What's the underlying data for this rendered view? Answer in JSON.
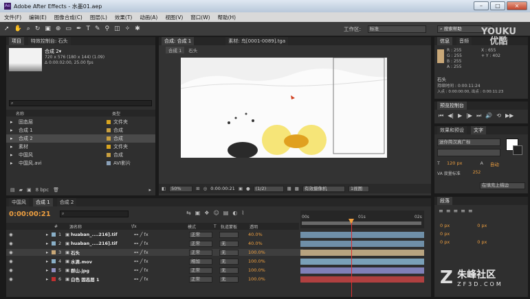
{
  "title": "Adobe After Effects - 水墨01.aep",
  "window_buttons": [
    "–",
    "□",
    "×"
  ],
  "menu": [
    "文件(F)",
    "编辑(E)",
    "图像合成(C)",
    "图层(L)",
    "效果(T)",
    "动画(A)",
    "视图(V)",
    "窗口(W)",
    "帮助(H)"
  ],
  "toolbar": {
    "workspace_label": "工作区:",
    "workspace_value": "标准",
    "search_placeholder": "搜索帮助"
  },
  "project": {
    "tab": "项目",
    "effects_tab": "特效控制台: 石头",
    "comp_name": "合成 2▾",
    "comp_info1": "720 x 576 (180 x 144) (1.09)",
    "comp_info2": "Δ 0:00:02:00, 25.00 fps",
    "col_name": "名称",
    "col_type": "类型",
    "items": [
      {
        "name": "固态层",
        "type": "文件夹",
        "color": "#d9a520",
        "selected": false
      },
      {
        "name": "合成 1",
        "type": "合成",
        "color": "#c9a040",
        "selected": false
      },
      {
        "name": "合成 2",
        "type": "合成",
        "color": "#c9a040",
        "selected": true
      },
      {
        "name": "素材",
        "type": "文件夹",
        "color": "#d9a520",
        "selected": false
      },
      {
        "name": "中国风",
        "type": "合成",
        "color": "#c9a040",
        "selected": false
      },
      {
        "name": "中国风.avi",
        "type": "AVI影片",
        "color": "#8aa0b8",
        "selected": false
      }
    ],
    "bpc": "8 bpc"
  },
  "comp_viewer": {
    "tab": "合成: 合成 1",
    "footage_tab": "素材: 鸟[0001-0089].tga",
    "crumbs": [
      "合成 1",
      "石头"
    ],
    "zoom": "50%",
    "timecode": "0:00:00:21",
    "resolution": "(1/2)",
    "camera": "有效摄像机",
    "views": "1视图"
  },
  "info": {
    "tab": "信息",
    "tab2": "音频",
    "r": "R : 255",
    "g": "G : 255",
    "b": "B : 255",
    "a": "A : 255",
    "x": "X : 655",
    "y": "+ Y : 402",
    "layer": "石头",
    "duration": "持续时间 : 0:00:11:24",
    "inout": "入点 : 0:00:00:00, 出点 : 0:00:11:23"
  },
  "preview": {
    "tab": "预览控制台"
  },
  "effects_panel": {
    "tab": "效果和预设",
    "tab2": "文字"
  },
  "text_panel": {
    "font": "迷你简汉真广标",
    "size": "120 px",
    "leading": "自动",
    "tracking": "VA 度量标准",
    "tracking_val": "252",
    "fill_stroke": "在填充上描边"
  },
  "paragraph": {
    "tab": "段落",
    "v1": "0 px",
    "v2": "0 px",
    "v3": "0 px",
    "v4": "0 px",
    "v5": "0 px"
  },
  "timeline": {
    "tabs": [
      "中国风",
      "合成 1",
      "合成 2"
    ],
    "timecode": "0:00:00:21",
    "col_num": "#",
    "col_source": "源名称",
    "col_switches": "\\fx",
    "col_mode": "模式",
    "col_t": "T",
    "col_trkmat": "轨道蒙板",
    "col_opacity": "透明",
    "ruler": [
      "00s",
      "01s",
      "02s"
    ],
    "layers": [
      {
        "n": "1",
        "name": "huaban_....216].tif",
        "mode": "正常",
        "trk": "",
        "opacity": "40.0%",
        "label": "#8ab0c8",
        "bar": "#6f8fa8"
      },
      {
        "n": "2",
        "name": "huaban_....216].tif",
        "mode": "正常",
        "trk": "无",
        "opacity": "40.0%",
        "label": "#8ab0c8",
        "bar": "#6f8fa8"
      },
      {
        "n": "3",
        "name": "石头",
        "mode": "正常",
        "trk": "无",
        "opacity": "100.0%",
        "label": "#c9a878",
        "bar": "#b8a480"
      },
      {
        "n": "4",
        "name": "水滴.mov",
        "mode": "相加",
        "trk": "无",
        "opacity": "100.0%",
        "label": "#8ab0c8",
        "bar": "#7aa0b8"
      },
      {
        "n": "5",
        "name": "群山.jpg",
        "mode": "正常",
        "trk": "无",
        "opacity": "100.0%",
        "label": "#9090c0",
        "bar": "#8080b8"
      },
      {
        "n": "6",
        "name": "白色 固态层 1",
        "mode": "正常",
        "trk": "无",
        "opacity": "100.0%",
        "label": "#c03030",
        "bar": "#b04040"
      }
    ]
  },
  "watermarks": {
    "youku1": "YOUKU",
    "youku2": "优酷",
    "zf1": "朱峰社区",
    "zf2": "ZF3D.COM"
  }
}
